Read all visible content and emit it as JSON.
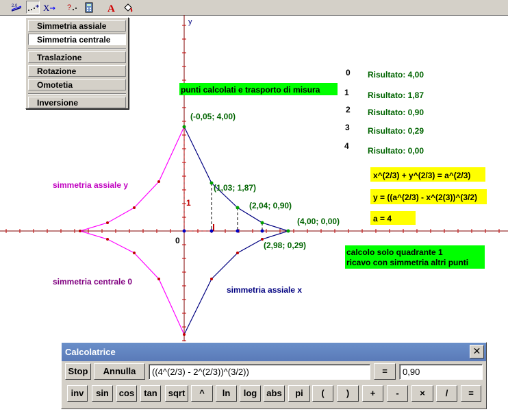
{
  "toolbar": {
    "icons": [
      "draw-tool-icon",
      "point-series-icon",
      "variable-icon",
      "query-icon",
      "calculator-icon",
      "text-tool-icon",
      "paint-bucket-icon"
    ]
  },
  "menu": {
    "items": [
      "Simmetria assiale",
      "Simmetria centrale",
      "Traslazione",
      "Rotazione",
      "Omotetia",
      "Inversione"
    ],
    "selected": "Simmetria centrale"
  },
  "plot": {
    "y_axis_label": "y",
    "origin_label": "0",
    "unit_label_y": "1",
    "unit_label_x": "1",
    "banner": "punti calcolati e trasporto di misura",
    "results": [
      {
        "index": "0",
        "label": "Risultato: 4,00"
      },
      {
        "index": "1",
        "label": "Risultato: 1,87"
      },
      {
        "index": "2",
        "label": "Risultato: 0,90"
      },
      {
        "index": "3",
        "label": "Risultato: 0,29"
      },
      {
        "index": "4",
        "label": "Risultato: 0,00"
      }
    ],
    "point_labels": [
      "(-0,05; 4,00)",
      "(1,03; 1,87)",
      "(2,04; 0,90)",
      "(4,00; 0,00)",
      "(2,98; 0,29)"
    ],
    "formula_1": "x^(2/3) + y^(2/3)  = a^(2/3)",
    "formula_2": "y = ((a^(2/3) - x^(2(3))^(3/2)",
    "parameter": "a = 4",
    "note_line1": "calcolo solo quadrante 1",
    "note_line2": "ricavo con simmetria altri punti",
    "label_sym_y": "simmetria assiale y",
    "label_sym_central": "simmetria centrale 0",
    "label_sym_x": "simmetria assiale x",
    "colors": {
      "green_banner": "#00ff00",
      "yellow_box": "#ffff00",
      "label_green": "#006400",
      "curve_quadrant1": "#000080",
      "curve_reflected": "#ff00ff",
      "point_red": "#c00000",
      "axis": "#800000"
    }
  },
  "calculator": {
    "title": "Calcolatrice",
    "stop": "Stop",
    "annulla": "Annulla",
    "expression": "((4^(2/3) - 2^(2/3))^(3/2))",
    "equals": "=",
    "result": "0,90",
    "keys": [
      "inv",
      "sin",
      "cos",
      "tan",
      "sqrt",
      "^",
      "ln",
      "log",
      "abs",
      "pi",
      "(",
      ")",
      "+",
      "-",
      "×",
      "/",
      "="
    ]
  }
}
